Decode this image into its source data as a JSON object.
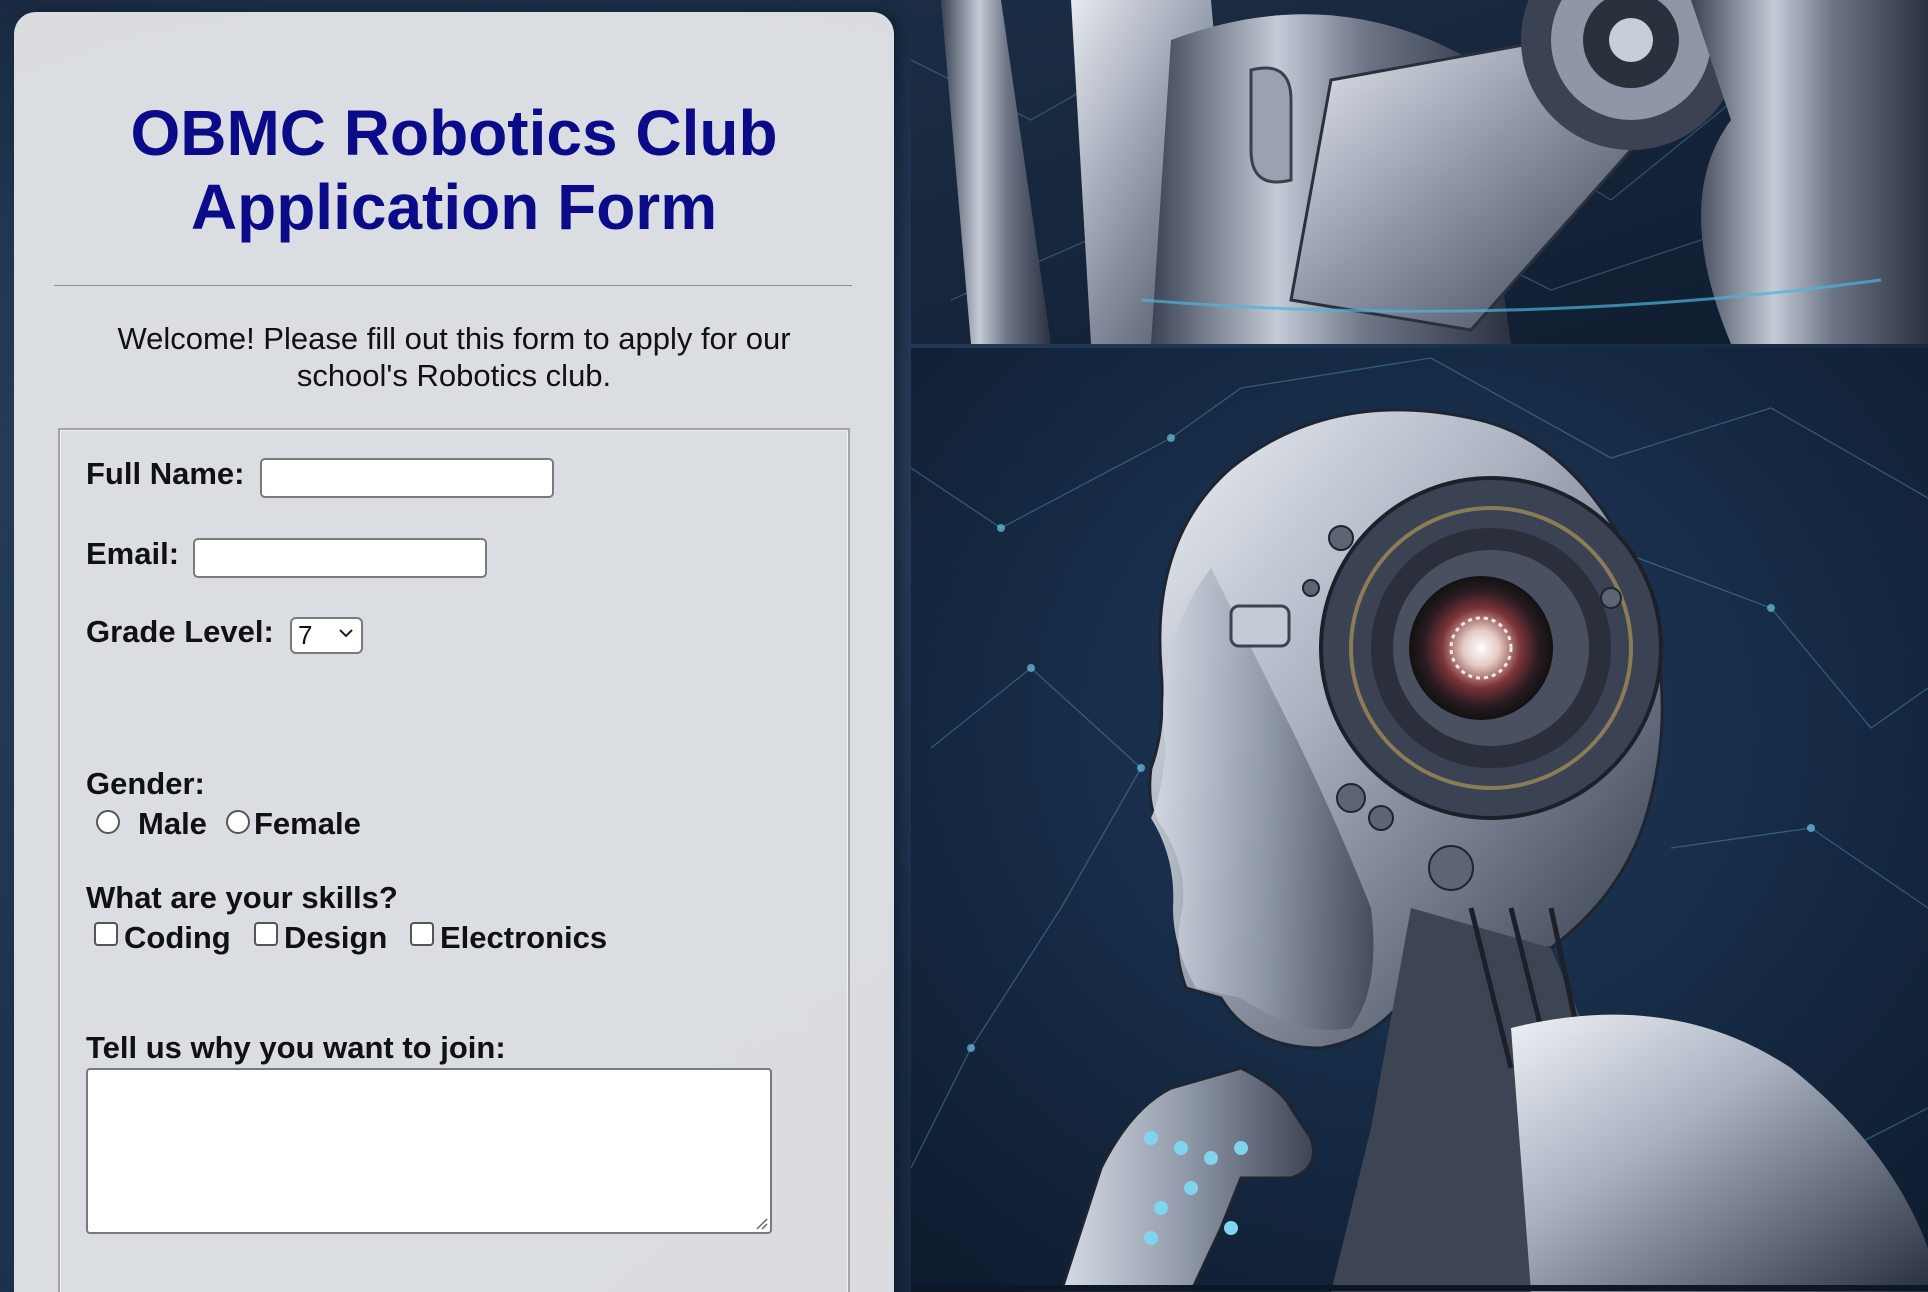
{
  "form": {
    "title_line1": "OBMC Robotics Club",
    "title_line2": "Application Form",
    "intro_line1": "Welcome! Please fill out this form to apply for our",
    "intro_line2": "school's Robotics club.",
    "full_name_label": "Full Name:",
    "full_name_value": "",
    "email_label": "Email:",
    "email_value": "",
    "grade_label": "Grade Level:",
    "grade_value": "7",
    "gender_label": "Gender:",
    "gender_options": [
      "Male",
      "Female"
    ],
    "skills_label": "What are your skills?",
    "skills_options": [
      "Coding",
      "Design",
      "Electronics"
    ],
    "why_label": "Tell us why you want to join:",
    "why_value": ""
  },
  "colors": {
    "title": "#0b0a88",
    "panel_bg": "#e2e4e7",
    "page_bg": "#1a2e4a"
  },
  "images": {
    "top": "robot-arm-closeup",
    "bottom": "thinking-robot-profile"
  }
}
